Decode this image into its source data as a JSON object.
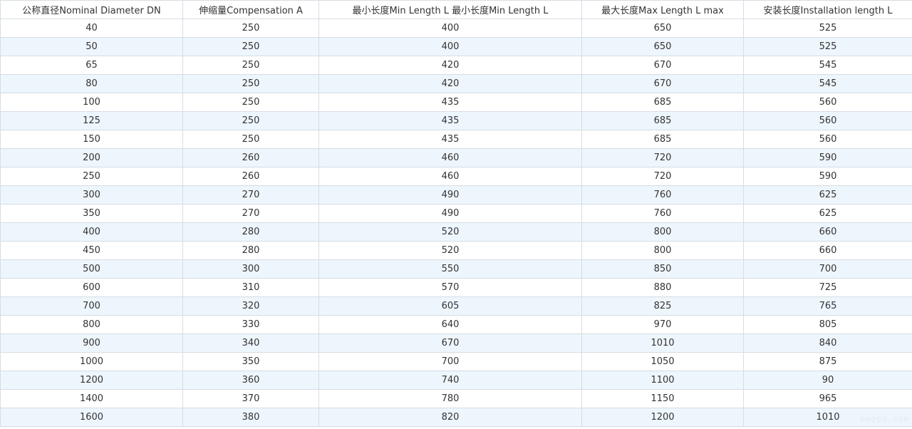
{
  "table": {
    "headers": [
      "公称直径Nominal Diameter DN",
      "伸缩量Compensation A",
      "最小长度Min Length L 最小长度Min Length L",
      "最大长度Max Length L max",
      "安装长度Installation length L"
    ],
    "rows": [
      [
        "40",
        "250",
        "400",
        "650",
        "525"
      ],
      [
        "50",
        "250",
        "400",
        "650",
        "525"
      ],
      [
        "65",
        "250",
        "420",
        "670",
        "545"
      ],
      [
        "80",
        "250",
        "420",
        "670",
        "545"
      ],
      [
        "100",
        "250",
        "435",
        "685",
        "560"
      ],
      [
        "125",
        "250",
        "435",
        "685",
        "560"
      ],
      [
        "150",
        "250",
        "435",
        "685",
        "560"
      ],
      [
        "200",
        "260",
        "460",
        "720",
        "590"
      ],
      [
        "250",
        "260",
        "460",
        "720",
        "590"
      ],
      [
        "300",
        "270",
        "490",
        "760",
        "625"
      ],
      [
        "350",
        "270",
        "490",
        "760",
        "625"
      ],
      [
        "400",
        "280",
        "520",
        "800",
        "660"
      ],
      [
        "450",
        "280",
        "520",
        "800",
        "660"
      ],
      [
        "500",
        "300",
        "550",
        "850",
        "700"
      ],
      [
        "600",
        "310",
        "570",
        "880",
        "725"
      ],
      [
        "700",
        "320",
        "605",
        "825",
        "765"
      ],
      [
        "800",
        "330",
        "640",
        "970",
        "805"
      ],
      [
        "900",
        "340",
        "670",
        "1010",
        "840"
      ],
      [
        "1000",
        "350",
        "700",
        "1050",
        "875"
      ],
      [
        "1200",
        "360",
        "740",
        "1100",
        "90"
      ],
      [
        "1400",
        "370",
        "780",
        "1150",
        "965"
      ],
      [
        "1600",
        "380",
        "820",
        "1200",
        "1010"
      ]
    ]
  },
  "watermark": "maggq.com",
  "colors": {
    "row_alt": "#eef6fd",
    "border": "#d6dde3",
    "text": "#333333"
  }
}
